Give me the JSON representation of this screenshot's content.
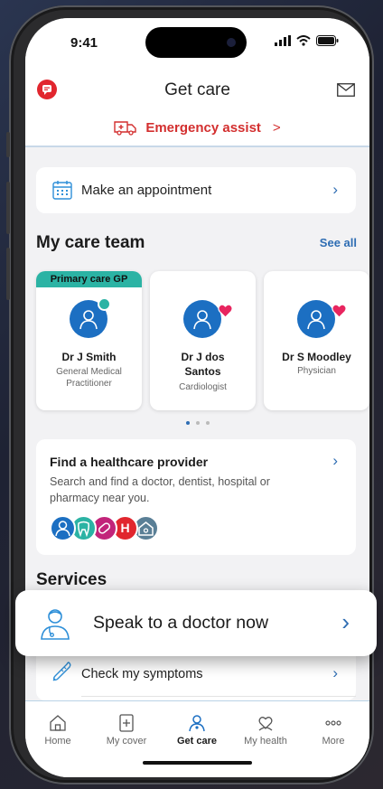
{
  "status_bar": {
    "time": "9:41"
  },
  "header": {
    "title": "Get care",
    "emergency_label": "Emergency assist",
    "emergency_chevron": ">"
  },
  "appointment": {
    "label": "Make an appointment"
  },
  "care_team": {
    "title": "My care team",
    "see_all": "See all",
    "members": [
      {
        "banner": "Primary care GP",
        "name": "Dr J Smith",
        "role": "General Medical Practitioner",
        "badge_color": "#2bb3a4",
        "badge_icon": "check-icon"
      },
      {
        "name": "Dr J dos Santos",
        "role": "Cardiologist",
        "badge_color": "#e8255f",
        "badge_icon": "heart-icon"
      },
      {
        "name": "Dr S Moodley",
        "role": "Physician",
        "badge_color": "#e8255f",
        "badge_icon": "heart-icon"
      }
    ]
  },
  "provider": {
    "title": "Find a healthcare provider",
    "description": "Search and find a doctor, dentist, hospital or pharmacy near you.",
    "icons": [
      {
        "name": "doctor-icon",
        "color": "#1c6fc2"
      },
      {
        "name": "tooth-icon",
        "color": "#2bb3a4"
      },
      {
        "name": "pill-icon",
        "color": "#c2247a"
      },
      {
        "name": "hospital-icon",
        "color": "#e1262e",
        "glyph": "H"
      },
      {
        "name": "home-care-icon",
        "color": "#5a7f96"
      }
    ]
  },
  "services": {
    "title": "Services",
    "speak_label": "Speak to a doctor now",
    "symptoms_label": "Check my symptoms"
  },
  "tabs": [
    {
      "label": "Home",
      "icon": "home-icon"
    },
    {
      "label": "My cover",
      "icon": "cover-icon"
    },
    {
      "label": "Get care",
      "icon": "doctor-icon",
      "active": true
    },
    {
      "label": "My health",
      "icon": "health-icon"
    },
    {
      "label": "More",
      "icon": "more-icon"
    }
  ],
  "colors": {
    "accent": "#2e6db3",
    "emergency": "#d32f2f",
    "gp_banner": "#2bb3a4"
  }
}
